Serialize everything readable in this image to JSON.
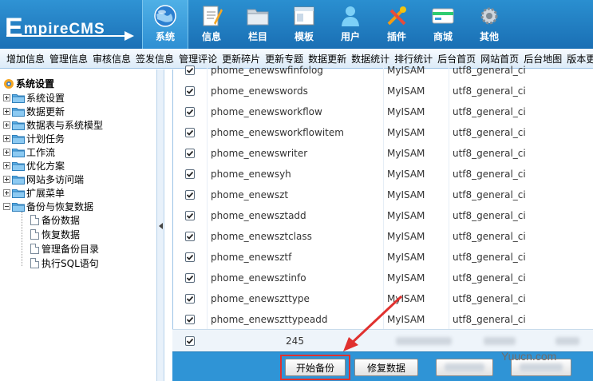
{
  "header": {
    "logo_text_big": "E",
    "logo_text_rest": "mpireCMS",
    "nav": [
      {
        "label": "系统",
        "icon": "globe-icon",
        "active": true
      },
      {
        "label": "信息",
        "icon": "notepad-icon",
        "active": false
      },
      {
        "label": "栏目",
        "icon": "folder-icon",
        "active": false
      },
      {
        "label": "模板",
        "icon": "window-icon",
        "active": false
      },
      {
        "label": "用户",
        "icon": "user-icon",
        "active": false
      },
      {
        "label": "插件",
        "icon": "tools-icon",
        "active": false
      },
      {
        "label": "商城",
        "icon": "card-icon",
        "active": false
      },
      {
        "label": "其他",
        "icon": "gear-icon",
        "active": false
      }
    ]
  },
  "subnav": [
    "增加信息",
    "管理信息",
    "审核信息",
    "签发信息",
    "管理评论",
    "更新碎片",
    "更新专题",
    "数据更新",
    "数据统计",
    "排行统计",
    "后台首页",
    "网站首页",
    "后台地图",
    "版本更"
  ],
  "sidebar": {
    "root": "系统设置",
    "items": [
      "系统设置",
      "数据更新",
      "数据表与系统模型",
      "计划任务",
      "工作流",
      "优化方案",
      "网站多访问端",
      "扩展菜单",
      "备份与恢复数据"
    ],
    "children": [
      "备份数据",
      "恢复数据",
      "管理备份目录",
      "执行SQL语句"
    ]
  },
  "table": {
    "rows": [
      {
        "name": "phome_enewswfinfolog",
        "engine": "MyISAM",
        "collation": "utf8_general_ci"
      },
      {
        "name": "phome_enewswords",
        "engine": "MyISAM",
        "collation": "utf8_general_ci"
      },
      {
        "name": "phome_enewsworkflow",
        "engine": "MyISAM",
        "collation": "utf8_general_ci"
      },
      {
        "name": "phome_enewsworkflowitem",
        "engine": "MyISAM",
        "collation": "utf8_general_ci"
      },
      {
        "name": "phome_enewswriter",
        "engine": "MyISAM",
        "collation": "utf8_general_ci"
      },
      {
        "name": "phome_enewsyh",
        "engine": "MyISAM",
        "collation": "utf8_general_ci"
      },
      {
        "name": "phome_enewszt",
        "engine": "MyISAM",
        "collation": "utf8_general_ci"
      },
      {
        "name": "phome_enewsztadd",
        "engine": "MyISAM",
        "collation": "utf8_general_ci"
      },
      {
        "name": "phome_enewsztclass",
        "engine": "MyISAM",
        "collation": "utf8_general_ci"
      },
      {
        "name": "phome_enewsztf",
        "engine": "MyISAM",
        "collation": "utf8_general_ci"
      },
      {
        "name": "phome_enewsztinfo",
        "engine": "MyISAM",
        "collation": "utf8_general_ci"
      },
      {
        "name": "phome_enewszttype",
        "engine": "MyISAM",
        "collation": "utf8_general_ci"
      },
      {
        "name": "phome_enewszttypeadd",
        "engine": "MyISAM",
        "collation": "utf8_general_ci"
      }
    ],
    "total_count": "245"
  },
  "buttons": {
    "start_backup": "开始备份",
    "repair": "修复数据"
  },
  "watermark": "Yuucn.com",
  "colors": {
    "header_blue": "#1a6fb4",
    "highlight_red": "#e0312f",
    "bar_blue": "#2f94d6"
  }
}
